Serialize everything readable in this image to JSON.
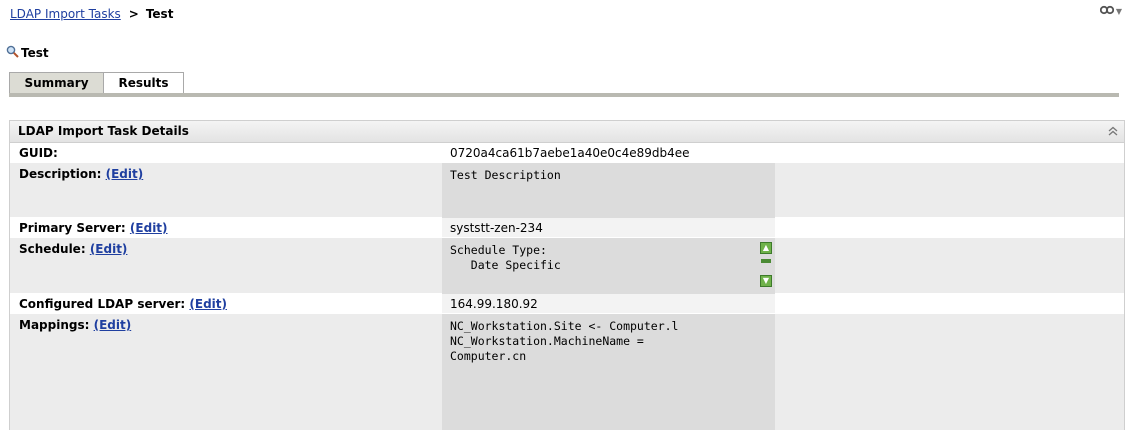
{
  "breadcrumb": {
    "parent": "LDAP Import Tasks",
    "separator": ">",
    "current": "Test"
  },
  "top_right": {
    "icon": "link-icon",
    "menu_arrow": "▼"
  },
  "page": {
    "title": "Test",
    "title_icon": "search-icon"
  },
  "tabs": [
    {
      "label": "Summary",
      "active": true
    },
    {
      "label": "Results",
      "active": false
    }
  ],
  "panel": {
    "title": "LDAP Import Task Details",
    "collapse_icon": "double-chevron-up-icon",
    "rows": {
      "guid": {
        "label": "GUID:",
        "value": "0720a4ca61b7aebe1a40e0c4e89db4ee"
      },
      "description": {
        "label": "Description:",
        "edit": "(Edit)",
        "value": "Test Description"
      },
      "primary_server": {
        "label": "Primary Server:",
        "edit": "(Edit)",
        "value": "syststt-zen-234"
      },
      "schedule": {
        "label": "Schedule:",
        "edit": "(Edit)",
        "value": "Schedule Type:\n   Date Specific"
      },
      "ldap_server": {
        "label": "Configured LDAP server:",
        "edit": "(Edit)",
        "value": "164.99.180.92"
      },
      "mappings": {
        "label": "Mappings:",
        "edit": "(Edit)",
        "value": "NC_Workstation.Site <- Computer.l\nNC_Workstation.MachineName =\nComputer.cn"
      }
    }
  },
  "colors": {
    "link": "#1f3fa0",
    "row_grey": "#ececec",
    "value_box": "#dcdcdc",
    "tab_active": "#dcdcd4"
  }
}
